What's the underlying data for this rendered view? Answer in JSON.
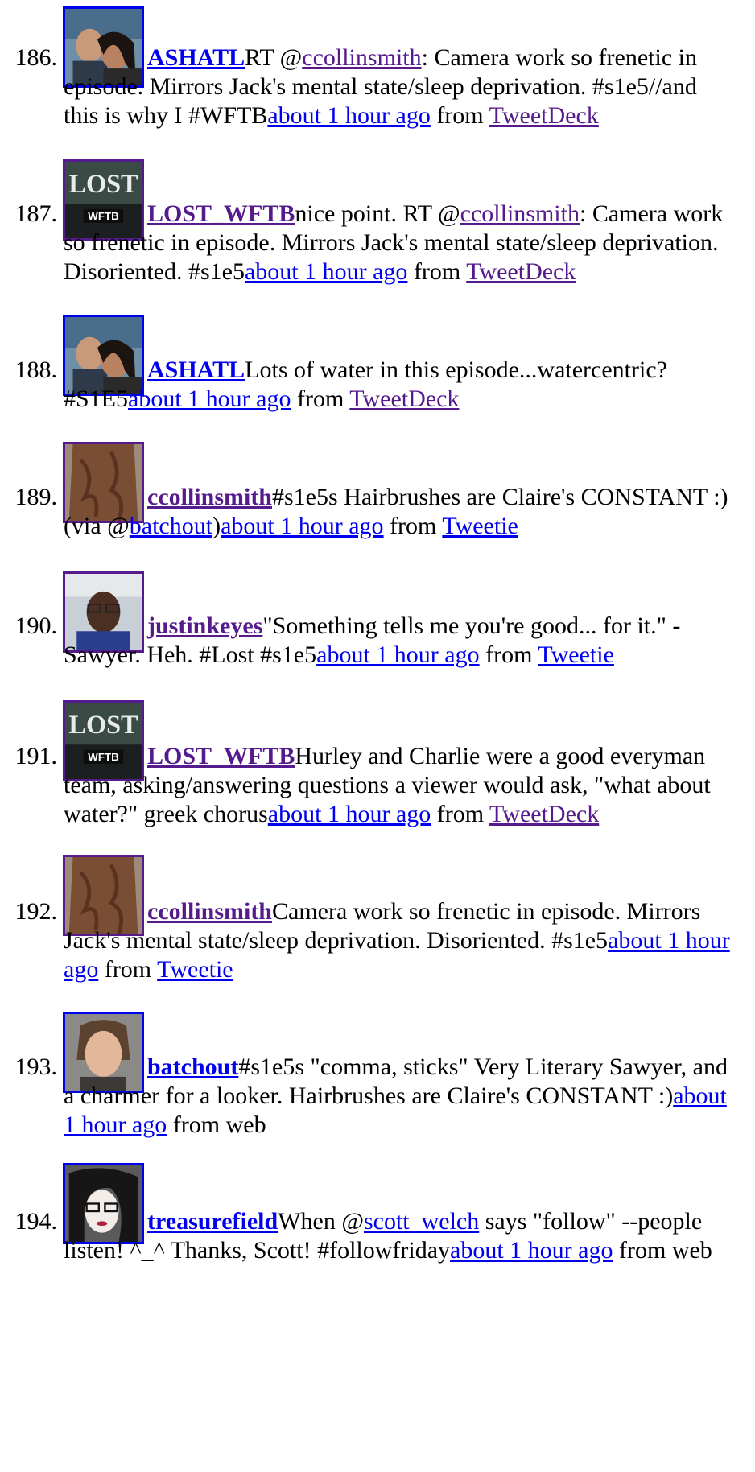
{
  "tweets": [
    {
      "num": "186.",
      "avatar": "couple-photo",
      "user": "ASHATL",
      "visited": false,
      "pre": "RT @",
      "mention": "ccollinsmith",
      "mention_visited": true,
      "text": ": Camera work so frenetic in episode. Mirrors Jack's mental state/sleep deprivation. #s1e5//and this is why I #WFTB",
      "time": "about 1 hour ago",
      "time_visited": false,
      "from": " from ",
      "source": "TweetDeck",
      "source_link": true,
      "source_visited": true
    },
    {
      "num": "187.",
      "avatar": "lost-wftb-logo",
      "user": "LOST_WFTB",
      "visited": true,
      "pre": "nice point. RT @",
      "mention": "ccollinsmith",
      "mention_visited": true,
      "text": ": Camera work so frenetic in episode. Mirrors Jack's mental state/sleep deprivation. Disoriented. #s1e5",
      "time": "about 1 hour ago",
      "time_visited": false,
      "from": " from ",
      "source": "TweetDeck",
      "source_link": true,
      "source_visited": true
    },
    {
      "num": "188.",
      "avatar": "couple-photo",
      "user": "ASHATL",
      "visited": false,
      "pre": "Lots of water in this episode...watercentric? #S1E5",
      "mention": "",
      "text": "",
      "time": "about 1 hour ago",
      "time_visited": false,
      "from": " from ",
      "source": "TweetDeck",
      "source_link": true,
      "source_visited": true
    },
    {
      "num": "189.",
      "avatar": "hair-photo",
      "user": "ccollinsmith",
      "visited": true,
      "pre": "#s1e5s Hairbrushes are Claire's CONSTANT :) (via @",
      "mention": "batchout",
      "mention_visited": false,
      "text": ")",
      "time": "about 1 hour ago",
      "time_visited": false,
      "from": " from ",
      "source": "Tweetie",
      "source_link": true,
      "source_visited": false
    },
    {
      "num": "190.",
      "avatar": "man-glasses-photo",
      "user": "justinkeyes",
      "visited": true,
      "pre": "\"Something tells me you're good... for it.\" - Sawyer. Heh. #Lost #s1e5",
      "mention": "",
      "text": "",
      "time": "about 1 hour ago",
      "time_visited": false,
      "from": " from ",
      "source": "Tweetie",
      "source_link": true,
      "source_visited": false
    },
    {
      "num": "191.",
      "avatar": "lost-wftb-logo",
      "user": "LOST_WFTB",
      "visited": true,
      "pre": "Hurley and Charlie were a good everyman team, asking/answering questions a viewer would ask, \"what about water?\" greek chorus",
      "mention": "",
      "text": "",
      "time": "about 1 hour ago",
      "time_visited": false,
      "from": " from ",
      "source": "TweetDeck",
      "source_link": true,
      "source_visited": true
    },
    {
      "num": "192.",
      "avatar": "hair-photo",
      "user": "ccollinsmith",
      "visited": true,
      "pre": "Camera work so frenetic in episode. Mirrors Jack's mental state/sleep deprivation. Disoriented. #s1e5",
      "mention": "",
      "text": "",
      "time": "about 1 hour ago",
      "time_visited": false,
      "from": " from ",
      "source": "Tweetie",
      "source_link": true,
      "source_visited": false
    },
    {
      "num": "193.",
      "avatar": "man-portrait-photo",
      "user": "batchout",
      "visited": false,
      "pre": "#s1e5s \"comma, sticks\" Very Literary Sawyer, and a charmer for a looker. Hairbrushes are Claire's CONSTANT :)",
      "mention": "",
      "text": "",
      "time": "about 1 hour ago",
      "time_visited": false,
      "from": " from ",
      "source": "web",
      "source_link": false,
      "source_visited": false
    },
    {
      "num": "194.",
      "avatar": "woman-glasses-photo",
      "user": "treasurefield",
      "visited": false,
      "pre": "When @",
      "mention": "scott_welch",
      "mention_visited": false,
      "text": " says \"follow\" --people listen! ^_^ Thanks, Scott! #followfriday",
      "time": "about 1 hour ago",
      "time_visited": false,
      "from": " from ",
      "source": "web",
      "source_link": false,
      "source_visited": false
    }
  ],
  "separator_glyph": "_"
}
